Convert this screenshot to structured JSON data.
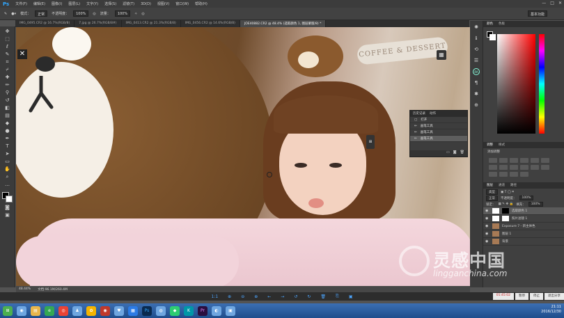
{
  "app": {
    "logo": "Ps",
    "menus": [
      "文件(F)",
      "编辑(E)",
      "图像(I)",
      "图层(L)",
      "文字(Y)",
      "选择(S)",
      "滤镜(T)",
      "3D(D)",
      "视图(V)",
      "窗口(W)",
      "帮助(H)"
    ],
    "window_controls": [
      "—",
      "□",
      "✕"
    ]
  },
  "options_bar": {
    "mode_label": "模式：",
    "mode_value": "正常",
    "opacity_label": "不透明度：",
    "opacity_value": "100%",
    "flow_label": "流量：",
    "flow_value": "100%",
    "workspace": "基本功能"
  },
  "tabs": [
    {
      "label": "IMG_0495.CR2 @ 16.7%(RGB/8)"
    },
    {
      "label": "7.jpg @ 26.7%(RGB/8#)"
    },
    {
      "label": "IMG_0413.CR2 @ 21.3%(RGB/8)"
    },
    {
      "label": "IMG_0456.CR2 @ 14.6%(RGB/8)"
    },
    {
      "label": "JOE40882.CR2 @ 48.4% (选取颜色 1, 图层蒙版/8) *"
    }
  ],
  "canvas": {
    "sign_text": "COFFEE & DESSERT"
  },
  "history": {
    "tabs": [
      "历史记录",
      "动作"
    ],
    "items": [
      "打开",
      "画笔工具",
      "画笔工具",
      "画笔工具"
    ]
  },
  "status": {
    "zoom": "48.44%",
    "doc": "文档:96.1M/260.4M"
  },
  "right_panel": {
    "color_tabs": [
      "颜色",
      "色板"
    ],
    "adjust_tabs": [
      "调整",
      "样式"
    ],
    "adjust_title": "添加调整",
    "layer_tabs": [
      "图层",
      "通道",
      "路径"
    ],
    "kind_label": "类型",
    "blend_mode": "正常",
    "opacity_label": "不透明度：",
    "opacity_value": "100%",
    "lock_label": "锁定：",
    "fill_label": "填充：",
    "fill_value": "100%",
    "layers": [
      {
        "name": "选取颜色 1",
        "thumb": "mask",
        "selected": true
      },
      {
        "name": "照片滤镜 1",
        "thumb": "white",
        "selected": false
      },
      {
        "name": "Exposure 7 - 新主体色",
        "thumb": "photo",
        "selected": false
      },
      {
        "name": "图层 1",
        "thumb": "photo",
        "selected": false
      },
      {
        "name": "背景",
        "thumb": "photo",
        "selected": false
      }
    ]
  },
  "watermark": {
    "title": "灵感中国",
    "url": "lingganchina.com"
  },
  "recorder": {
    "time": "01:45:02",
    "buttons": [
      "暂停",
      "停止",
      "退出分享"
    ]
  },
  "bottom_controls": [
    "1:1",
    "⊕",
    "⊖",
    "⊕",
    "←",
    "→",
    "↺",
    "↻",
    "🗑",
    "⎘",
    "▣"
  ],
  "taskbar": {
    "clock": "21:11",
    "date": "2016/12/30"
  },
  "colors": {
    "accent": "#31a8ff"
  }
}
